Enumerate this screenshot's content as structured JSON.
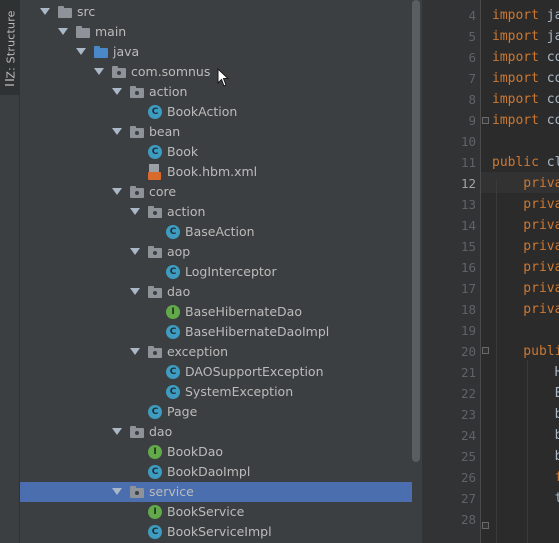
{
  "sidebar": {
    "structure_label": "Z: Structure"
  },
  "tree": [
    {
      "label": "src",
      "depth": 0,
      "kind": "folder-src",
      "expanded": true
    },
    {
      "label": "main",
      "depth": 1,
      "kind": "folder",
      "expanded": true
    },
    {
      "label": "java",
      "depth": 2,
      "kind": "folder-java",
      "expanded": true
    },
    {
      "label": "com.somnus",
      "depth": 3,
      "kind": "package",
      "expanded": true
    },
    {
      "label": "action",
      "depth": 4,
      "kind": "package",
      "expanded": true
    },
    {
      "label": "BookAction",
      "depth": 5,
      "kind": "class"
    },
    {
      "label": "bean",
      "depth": 4,
      "kind": "package",
      "expanded": true
    },
    {
      "label": "Book",
      "depth": 5,
      "kind": "class"
    },
    {
      "label": "Book.hbm.xml",
      "depth": 5,
      "kind": "xml"
    },
    {
      "label": "core",
      "depth": 4,
      "kind": "package",
      "expanded": true
    },
    {
      "label": "action",
      "depth": 5,
      "kind": "package",
      "expanded": true
    },
    {
      "label": "BaseAction",
      "depth": 6,
      "kind": "class"
    },
    {
      "label": "aop",
      "depth": 5,
      "kind": "package",
      "expanded": true
    },
    {
      "label": "LogInterceptor",
      "depth": 6,
      "kind": "class"
    },
    {
      "label": "dao",
      "depth": 5,
      "kind": "package",
      "expanded": true
    },
    {
      "label": "BaseHibernateDao",
      "depth": 6,
      "kind": "interface"
    },
    {
      "label": "BaseHibernateDaoImpl",
      "depth": 6,
      "kind": "class"
    },
    {
      "label": "exception",
      "depth": 5,
      "kind": "package",
      "expanded": true
    },
    {
      "label": "DAOSupportException",
      "depth": 6,
      "kind": "class"
    },
    {
      "label": "SystemException",
      "depth": 6,
      "kind": "class"
    },
    {
      "label": "Page",
      "depth": 5,
      "kind": "class"
    },
    {
      "label": "dao",
      "depth": 4,
      "kind": "package",
      "expanded": true
    },
    {
      "label": "BookDao",
      "depth": 5,
      "kind": "interface"
    },
    {
      "label": "BookDaoImpl",
      "depth": 5,
      "kind": "class"
    },
    {
      "label": "service",
      "depth": 4,
      "kind": "package",
      "expanded": true,
      "selected": true
    },
    {
      "label": "BookService",
      "depth": 5,
      "kind": "interface"
    },
    {
      "label": "BookServiceImpl",
      "depth": 5,
      "kind": "class"
    }
  ],
  "editor": {
    "current_line": "12",
    "lines": [
      {
        "num": "4",
        "kw": "import",
        "rest": " ja"
      },
      {
        "num": "5",
        "kw": "import",
        "rest": " ja"
      },
      {
        "num": "6",
        "kw": "import",
        "rest": " co"
      },
      {
        "num": "7",
        "kw": "import",
        "rest": " co"
      },
      {
        "num": "8",
        "kw": "import",
        "rest": " co"
      },
      {
        "num": "9",
        "kw": "import",
        "rest": " co"
      },
      {
        "num": "10",
        "kw": "",
        "rest": ""
      },
      {
        "num": "11",
        "kw": "public",
        "rest": " cl"
      },
      {
        "num": "12",
        "kw": "    priva",
        "rest": ""
      },
      {
        "num": "13",
        "kw": "    priva",
        "rest": ""
      },
      {
        "num": "14",
        "kw": "    priva",
        "rest": ""
      },
      {
        "num": "15",
        "kw": "    priva",
        "rest": ""
      },
      {
        "num": "16",
        "kw": "    priva",
        "rest": ""
      },
      {
        "num": "17",
        "kw": "    priva",
        "rest": ""
      },
      {
        "num": "18",
        "kw": "    priva",
        "rest": ""
      },
      {
        "num": "19",
        "kw": "",
        "rest": ""
      },
      {
        "num": "20",
        "kw": "    publi",
        "rest": ""
      },
      {
        "num": "21",
        "kw": "",
        "rest": "        H"
      },
      {
        "num": "22",
        "kw": "",
        "rest": "        E"
      },
      {
        "num": "23",
        "kw": "",
        "rest": "        b"
      },
      {
        "num": "24",
        "kw": "",
        "rest": "        b"
      },
      {
        "num": "25",
        "kw": "",
        "rest": "        b"
      },
      {
        "num": "26",
        "kw": "        f",
        "rest": ""
      },
      {
        "num": "27",
        "kw": "",
        "rest": "        t"
      },
      {
        "num": "28",
        "kw": "",
        "rest": ""
      }
    ]
  }
}
